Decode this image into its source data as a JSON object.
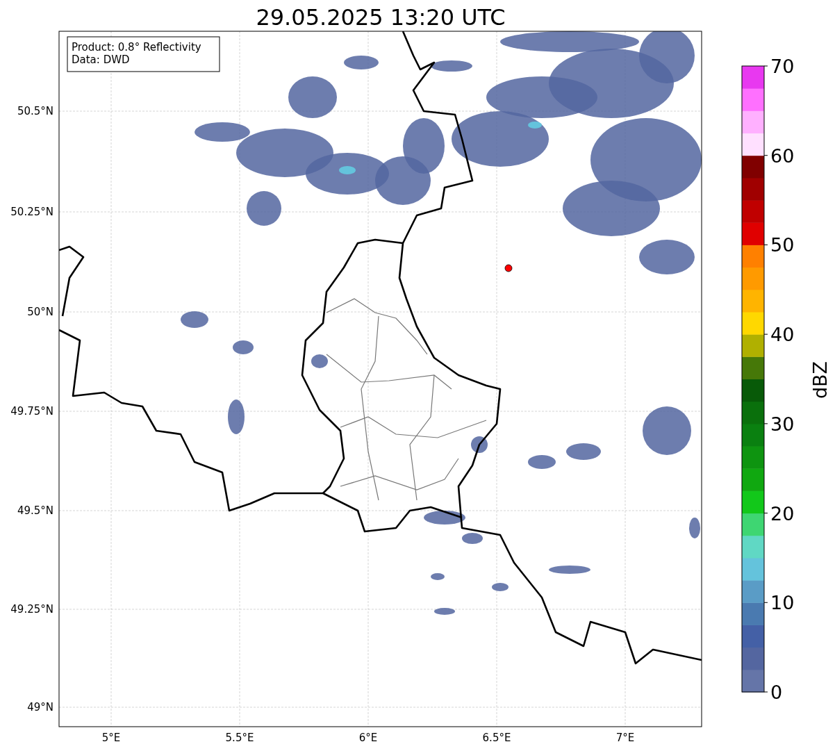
{
  "title": "29.05.2025 13:20 UTC",
  "info_box": [
    "Product: 0.8° Reflectivity",
    "Data: DWD"
  ],
  "map": {
    "lat_labels": [
      "50.5°N",
      "50.25°N",
      "50°N",
      "49.75°N",
      "49.5°N",
      "49.25°N",
      "49°N"
    ],
    "lon_labels": [
      "5°E",
      "5.5°E",
      "6°E",
      "6.5°E",
      "7°E"
    ]
  },
  "colorbar": {
    "label": "dBZ",
    "ticks": [
      "70",
      "60",
      "50",
      "40",
      "30",
      "20",
      "10",
      "0"
    ],
    "bands": [
      {
        "color": "#6575a8"
      },
      {
        "color": "#5466a0"
      },
      {
        "color": "#4460a6"
      },
      {
        "color": "#4a7ab0"
      },
      {
        "color": "#5a9cc6"
      },
      {
        "color": "#64c3dc"
      },
      {
        "color": "#60d8c4"
      },
      {
        "color": "#3ed672"
      },
      {
        "color": "#12c81a"
      },
      {
        "color": "#10a810"
      },
      {
        "color": "#0e9410"
      },
      {
        "color": "#0a8010"
      },
      {
        "color": "#0a700c"
      },
      {
        "color": "#085a08"
      },
      {
        "color": "#467808"
      },
      {
        "color": "#b0b000"
      },
      {
        "color": "#ffd800"
      },
      {
        "color": "#ffb400"
      },
      {
        "color": "#ff9a00"
      },
      {
        "color": "#ff8000"
      },
      {
        "color": "#e00000"
      },
      {
        "color": "#c00000"
      },
      {
        "color": "#a00000"
      },
      {
        "color": "#800000"
      },
      {
        "color": "#ffe0ff"
      },
      {
        "color": "#ffb0ff"
      },
      {
        "color": "#ff70ff"
      },
      {
        "color": "#e838f0"
      }
    ]
  }
}
